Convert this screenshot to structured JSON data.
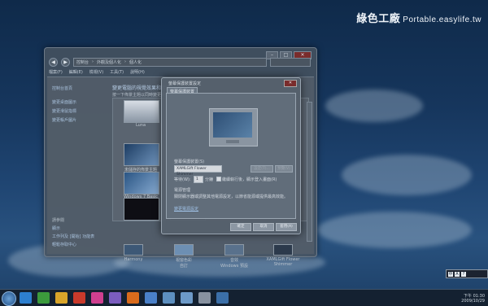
{
  "watermark": {
    "brand": "綠色工廠",
    "site": "Portable.easylife.tw"
  },
  "explorer": {
    "address_parts": [
      "控制台",
      "外觀及個人化",
      "個人化"
    ],
    "menu": [
      "檔案(F)",
      "編輯(E)",
      "檢視(V)",
      "工具(T)",
      "說明(H)"
    ],
    "left_links": [
      "控制台首頁",
      "變更桌面圖示",
      "變更滑鼠指標",
      "變更帳戶圖片"
    ],
    "see_also_title": "請參閱",
    "see_also_links": [
      "顯示",
      "工作列及 [開始] 功能表",
      "輕鬆存取中心"
    ],
    "title": "變更電腦的視覺效果和音效",
    "subtitle": "按一下佈景主題以同時變更桌面背景、視窗色彩、音效及螢幕保護裝置。",
    "themes": [
      {
        "name": "Luna"
      },
      {
        "name": "未儲存的佈景主題"
      },
      {
        "name": "Windows 7 Basic"
      },
      {
        "name": "Windows 經典"
      },
      {
        "name": "高對比 #1"
      },
      {
        "name": "高對比 #2"
      },
      {
        "name": "高對比白色"
      },
      {
        "name": "高對比黑色"
      }
    ],
    "bottom_items": [
      {
        "title": "桌面背景",
        "sub": "Harmony"
      },
      {
        "title": "視窗色彩",
        "sub": "自訂"
      },
      {
        "title": "音效",
        "sub": "Windows 預設"
      },
      {
        "title": "螢幕保護裝置",
        "sub": "XAMLGift Flower Shimmer"
      }
    ]
  },
  "dialog": {
    "title": "螢幕保護裝置設定",
    "tab": "螢幕保護裝置",
    "screensaver_label": "螢幕保護裝置(S)",
    "screensaver_value": "XAMLGift Flower Shimmer",
    "settings_button": "設定(T)...",
    "preview_button": "預覽(V)",
    "wait_label": "等待(W):",
    "wait_value": "1",
    "minutes_label": "分鐘",
    "resume_label": "繼續執行後，顯示登入畫面(R)",
    "power_title": "電源管理",
    "power_text": "關閉顯示器或調整其他電源設定，以節省能源或提供最高效能。",
    "power_link": "變更電源設定",
    "ok": "確定",
    "cancel": "取消",
    "apply": "套用(A)"
  },
  "taskbar": {
    "time": "下午 01:30",
    "date": "2009/10/29",
    "icon_colors": [
      "#2d7fcf",
      "#3c9a3c",
      "#d9a52a",
      "#c93a2b",
      "#cf3f8f",
      "#7b5dbe",
      "#d96b1c",
      "#4a80c8",
      "#5d8fbf",
      "#6d9ac8",
      "#8892a0",
      "#3b6fa8"
    ]
  },
  "language_bar": {
    "items": [
      "中",
      "A",
      "?"
    ]
  }
}
